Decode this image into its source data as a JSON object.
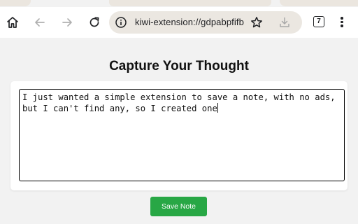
{
  "browser": {
    "url": "kiwi-extension://gdpabpfifb",
    "tab_count": "7",
    "icons": {
      "home": "home-icon",
      "back": "arrow-left-icon",
      "forward": "arrow-right-icon",
      "reload": "reload-icon",
      "site_info": "info-icon",
      "bookmark": "star-icon",
      "download": "download-icon",
      "menu": "more-vertical-icon"
    }
  },
  "page": {
    "title": "Capture Your Thought",
    "note_text": "I just wanted a simple extension to save a note, with no ads, but I can't find any, so I created one",
    "save_label": "Save Note",
    "colors": {
      "save_button": "#28a745",
      "background": "#f2f2f2"
    }
  }
}
